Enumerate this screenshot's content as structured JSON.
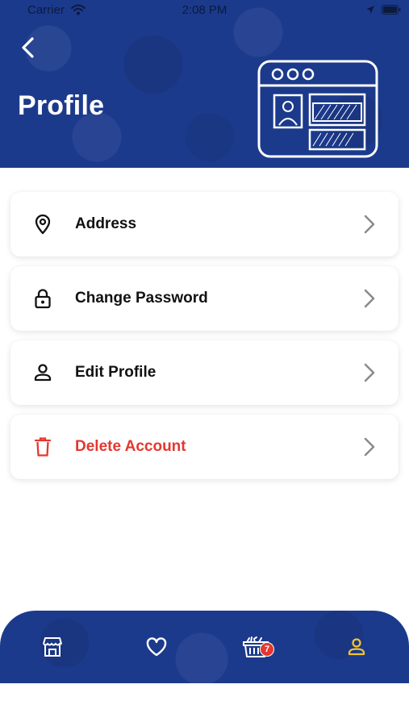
{
  "status_bar": {
    "carrier": "Carrier",
    "time": "2:08 PM"
  },
  "header": {
    "title": "Profile",
    "background_color": "#1c3a8c"
  },
  "menu": {
    "items": [
      {
        "label": "Address",
        "icon": "location-pin-icon"
      },
      {
        "label": "Change Password",
        "icon": "lock-icon"
      },
      {
        "label": "Edit Profile",
        "icon": "user-icon"
      },
      {
        "label": "Delete Account",
        "icon": "trash-icon",
        "color": "#e5372f"
      }
    ]
  },
  "tab_bar": {
    "tabs": [
      {
        "name": "store",
        "icon": "store-icon"
      },
      {
        "name": "favorites",
        "icon": "heart-icon"
      },
      {
        "name": "basket",
        "icon": "basket-icon",
        "badge": "7"
      },
      {
        "name": "profile",
        "icon": "user-icon",
        "active": true,
        "active_color": "#f2c230"
      }
    ]
  }
}
